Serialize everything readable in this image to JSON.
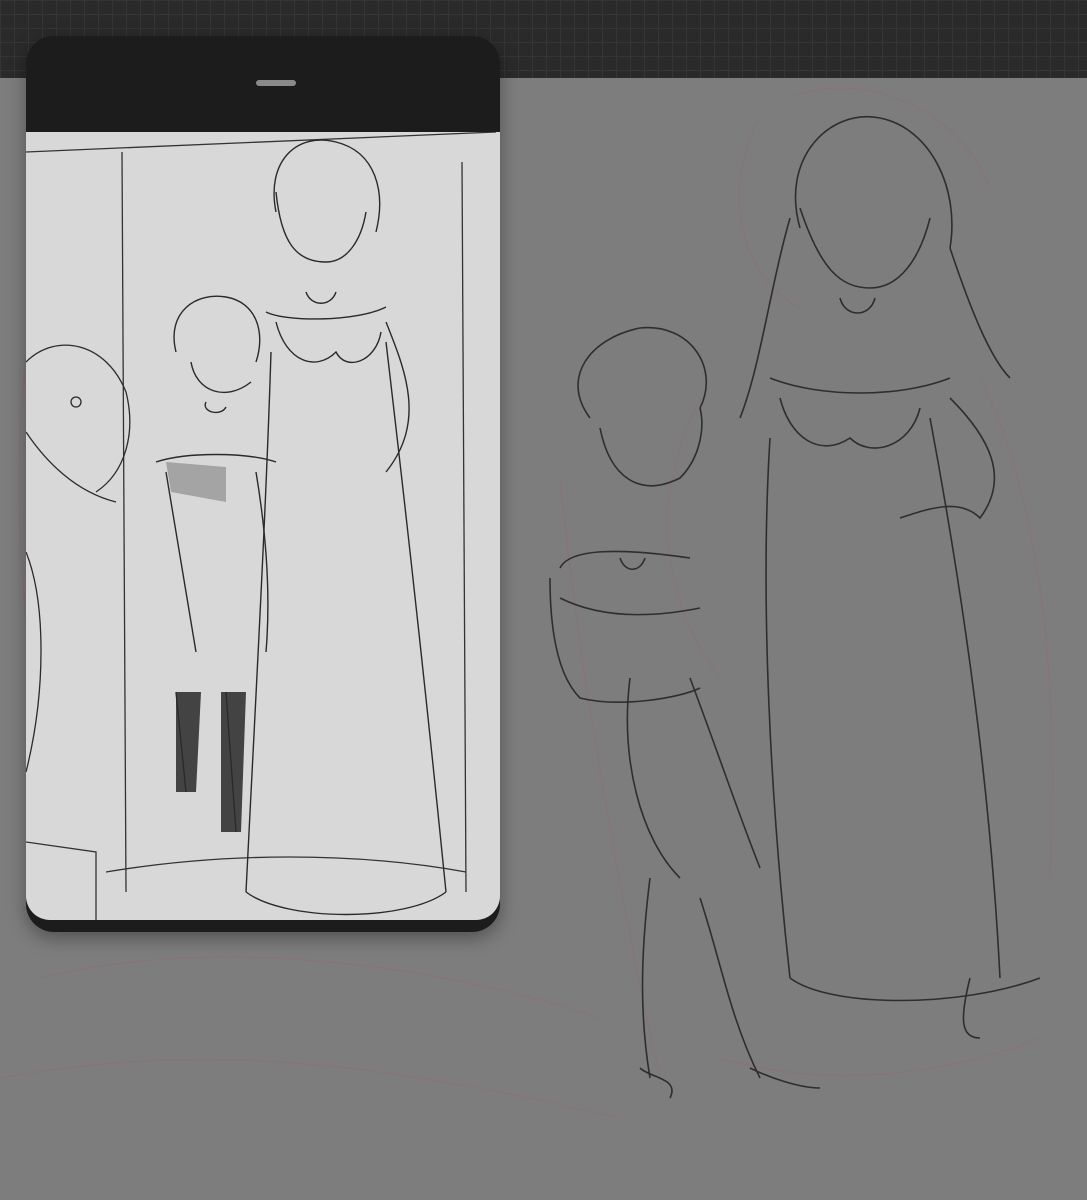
{
  "app": {
    "colors": {
      "workspace_dark": "#2a2a2a",
      "canvas_gray": "#7d7d7d",
      "reference_bg": "#d8d8d8",
      "reference_frame": "#1c1c1c",
      "sketch_line": "#2e2e2e",
      "rough_sketch": "#8e6f6f"
    }
  },
  "reference_window": {
    "icon": "drag-handle-icon"
  },
  "canvas": {
    "content": "sketch-artwork"
  }
}
